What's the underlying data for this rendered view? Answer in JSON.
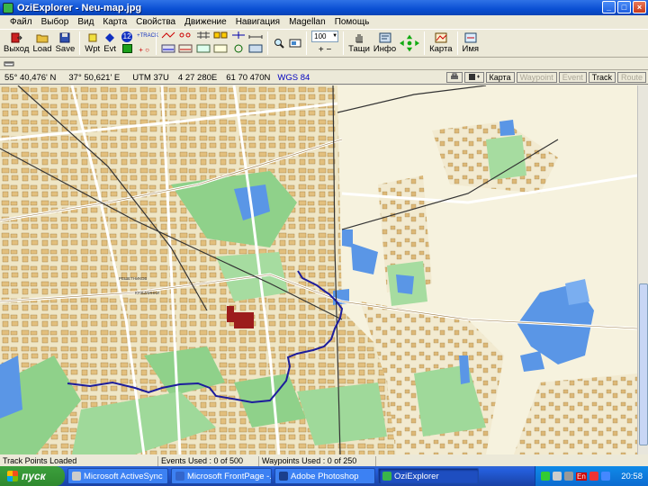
{
  "window": {
    "title": "OziExplorer - Neu-map.jpg",
    "controls": [
      "_",
      "□",
      "×"
    ]
  },
  "menu": [
    "Файл",
    "Выбор",
    "Вид",
    "Карта",
    "Свойства",
    "Движение",
    "Навигация",
    "Magellan",
    "Помощь"
  ],
  "toolbar": {
    "exit_label": "Выход",
    "load_label": "Load",
    "save_label": "Save",
    "wpt_label": "Wpt",
    "evt_label": "Evt",
    "track_num": "12",
    "track_label": "+TRACK",
    "zoom_value": "100",
    "hand_label": "Тащи",
    "info_label": "Инфо",
    "map_label": "Карта",
    "name_label": "Имя"
  },
  "coords": {
    "lat": "55° 40,476' N",
    "lon": "37° 50,621' E",
    "utm": "UTM  37U",
    "easting": "4 27 280E",
    "northing": "61 70 470N",
    "datum": "WGS 84"
  },
  "view_buttons": {
    "map": "Карта",
    "waypoint": "Waypoint",
    "event": "Event",
    "track": "Track",
    "route": "Route"
  },
  "map_labels": {
    "district_1": "РЕШЕТНИКОВ",
    "district_2": "КУЗЬМИНКИ"
  },
  "status": {
    "track_points": "Track Points Loaded",
    "events": "Events Used : 0 of 500",
    "waypoints": "Waypoints Used : 0 of 250"
  },
  "taskbar": {
    "start": "пуск",
    "tasks": [
      "Microsoft ActiveSync",
      "Microsoft FrontPage -...",
      "Adobe Photoshop",
      "OziExplorer"
    ],
    "lang": "En",
    "clock": "20:58"
  },
  "colors": {
    "track": "#1c1c9c",
    "water": "#5a96e6",
    "park": "#8fd18a",
    "building": "#e8c98c",
    "highlight": "#9c1c1c"
  }
}
